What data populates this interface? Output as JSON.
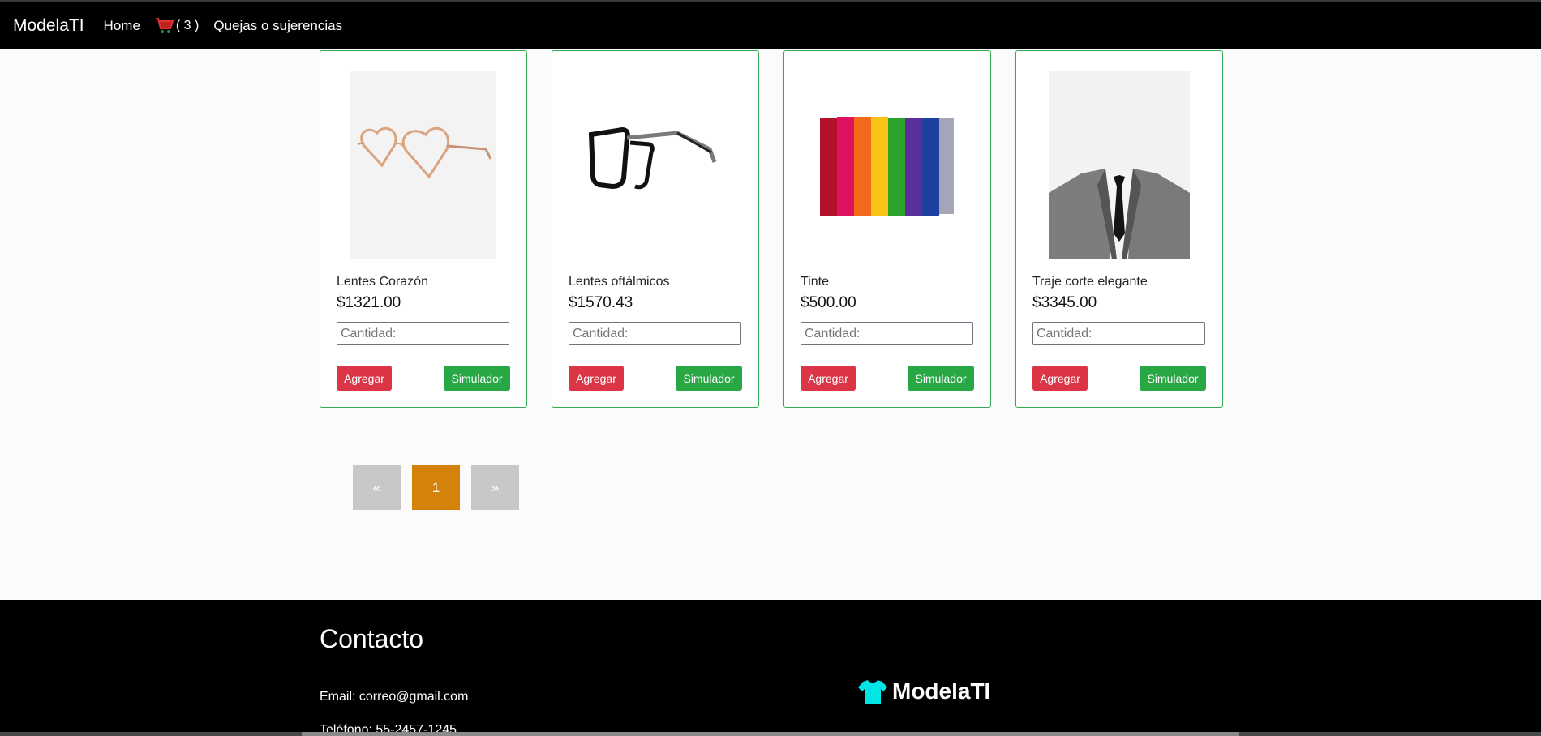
{
  "nav": {
    "brand": "ModelaTI",
    "home": "Home",
    "cart_count": "( 3 )",
    "complaints": "Quejas o sujerencias"
  },
  "products": [
    {
      "name": "Lentes Corazón",
      "price": "$1321.00",
      "qty_placeholder": "Cantidad:",
      "add_label": "Agregar",
      "sim_label": "Simulador"
    },
    {
      "name": "Lentes oftálmicos",
      "price": "$1570.43",
      "qty_placeholder": "Cantidad:",
      "add_label": "Agregar",
      "sim_label": "Simulador"
    },
    {
      "name": "Tinte",
      "price": "$500.00",
      "qty_placeholder": "Cantidad:",
      "add_label": "Agregar",
      "sim_label": "Simulador"
    },
    {
      "name": "Traje corte elegante",
      "price": "$3345.00",
      "qty_placeholder": "Cantidad:",
      "add_label": "Agregar",
      "sim_label": "Simulador"
    }
  ],
  "pagination": {
    "prev": "«",
    "current": "1",
    "next": "»"
  },
  "footer": {
    "title": "Contacto",
    "email": "Email: correo@gmail.com",
    "phone": "Teléfono: 55-2457-1245",
    "brand": "ModelaTI"
  },
  "colors": {
    "add_button": "#dc3545",
    "simulator_button": "#28a745",
    "card_border": "#2fa84f",
    "current_page": "#d4820a",
    "shirt_icon": "#00e5e5"
  },
  "icons": {
    "cart": "cart-icon",
    "footer_brand": "shirt-icon"
  }
}
